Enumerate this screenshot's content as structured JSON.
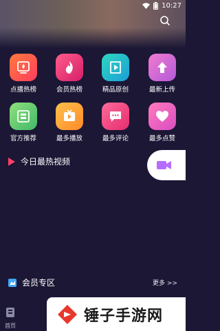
{
  "status_bar": {
    "time": "10:27"
  },
  "grid": [
    {
      "label": "点播热榜",
      "icon": "fire-sign-icon",
      "color": "#ff5a3c"
    },
    {
      "label": "会员热榜",
      "icon": "flame-icon",
      "color": "#ff3f7a"
    },
    {
      "label": "精品原创",
      "icon": "play-circle-icon",
      "color": "#21c8a8"
    },
    {
      "label": "最新上传",
      "icon": "upload-arrow-icon",
      "color": "#e06cbf"
    },
    {
      "label": "官方推荐",
      "icon": "official-badge-icon",
      "color": "#7ed36a"
    },
    {
      "label": "最多播放",
      "icon": "tv-play-icon",
      "color": "#ffb432"
    },
    {
      "label": "最多评论",
      "icon": "comment-icon",
      "color": "#ff3f7a"
    },
    {
      "label": "最多点赞",
      "icon": "heart-icon",
      "color": "#ff5fa8"
    }
  ],
  "sections": {
    "hot_today": "今日最热视频",
    "vip_zone": "会员专区",
    "more": "更多 >>"
  },
  "tabbar": {
    "home": "首页"
  },
  "watermark": {
    "text": "锤子手游网"
  }
}
